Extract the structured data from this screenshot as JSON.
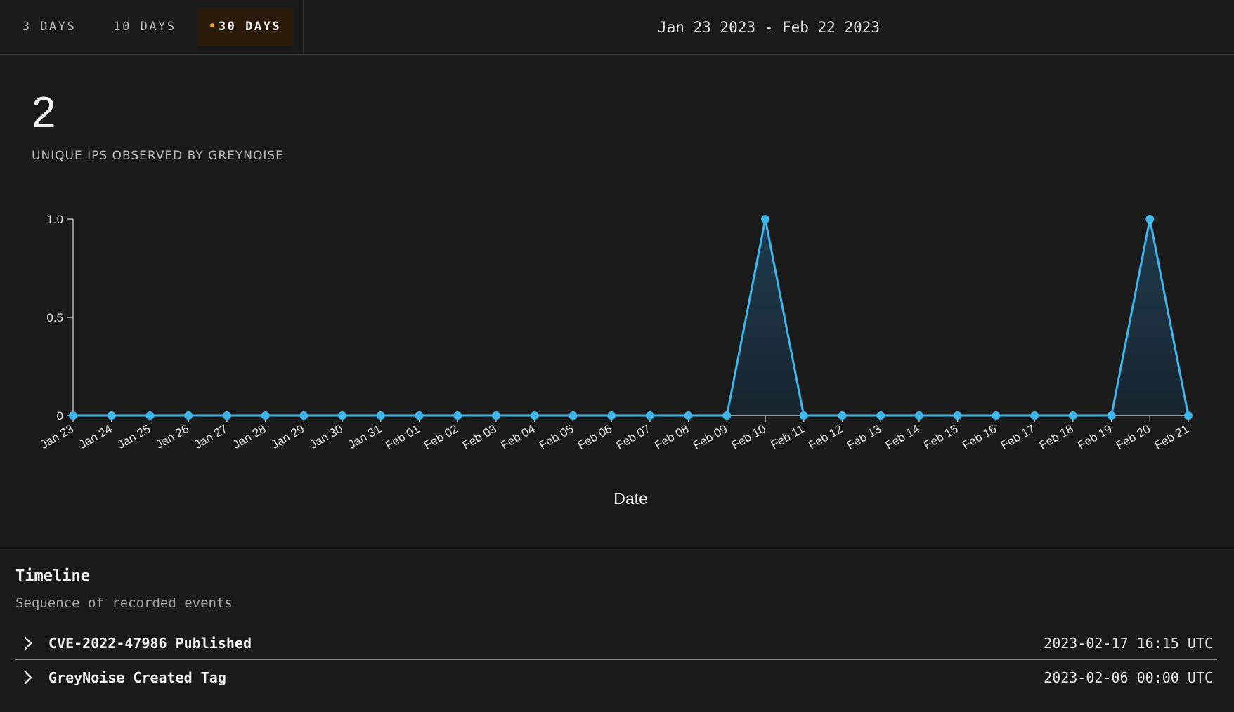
{
  "range_tabs": [
    {
      "label": "3 DAYS",
      "active": false
    },
    {
      "label": "10 DAYS",
      "active": false
    },
    {
      "label": "30 DAYS",
      "active": true
    }
  ],
  "accent_color": "#f0a030",
  "date_range": "Jan 23 2023 - Feb 22 2023",
  "summary": {
    "count": "2",
    "label": "UNIQUE IPS OBSERVED BY GREYNOISE"
  },
  "chart_data": {
    "type": "area",
    "categories": [
      "Jan 23",
      "Jan 24",
      "Jan 25",
      "Jan 26",
      "Jan 27",
      "Jan 28",
      "Jan 29",
      "Jan 30",
      "Jan 31",
      "Feb 01",
      "Feb 02",
      "Feb 03",
      "Feb 04",
      "Feb 05",
      "Feb 06",
      "Feb 07",
      "Feb 08",
      "Feb 09",
      "Feb 10",
      "Feb 11",
      "Feb 12",
      "Feb 13",
      "Feb 14",
      "Feb 15",
      "Feb 16",
      "Feb 17",
      "Feb 18",
      "Feb 19",
      "Feb 20",
      "Feb 21"
    ],
    "values": [
      0,
      0,
      0,
      0,
      0,
      0,
      0,
      0,
      0,
      0,
      0,
      0,
      0,
      0,
      0,
      0,
      0,
      0,
      1,
      0,
      0,
      0,
      0,
      0,
      0,
      0,
      0,
      0,
      1,
      0
    ],
    "xlabel": "Date",
    "ylabel": "",
    "ylim": [
      0,
      1
    ],
    "yticks": [
      "0",
      "0.5",
      "1.0"
    ],
    "grid": false,
    "line_color": "#3fb6ec",
    "fill_color": "#1d3a4c"
  },
  "timeline": {
    "title": "Timeline",
    "subtitle": "Sequence of recorded events",
    "events": [
      {
        "title": "CVE-2022-47986 Published",
        "time": "2023-02-17 16:15 UTC"
      },
      {
        "title": "GreyNoise Created Tag",
        "time": "2023-02-06 00:00 UTC"
      }
    ]
  }
}
